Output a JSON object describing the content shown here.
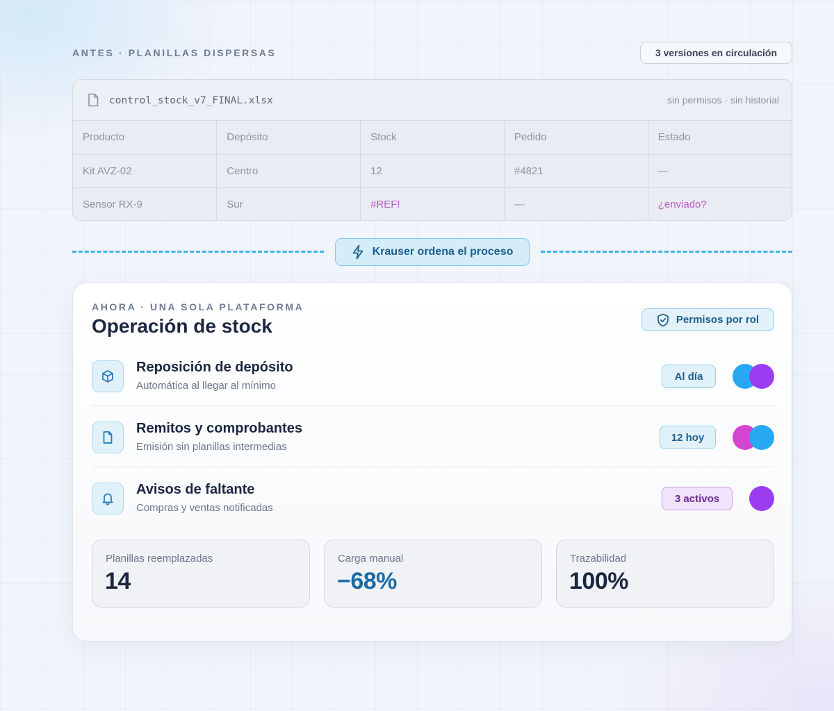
{
  "before": {
    "label": "ANTES · PLANILLAS DISPERSAS",
    "versions_badge": "3 versiones en circulación",
    "file": {
      "icon": "file-icon",
      "name": "control_stock_v7_FINAL.xlsx",
      "meta": "sin permisos · sin historial"
    },
    "columns": [
      "Producto",
      "Depósito",
      "Stock",
      "Pedido",
      "Estado"
    ],
    "rows": [
      [
        "Kit AVZ-02",
        "Centro",
        "12",
        "#4821",
        "—"
      ],
      [
        "Sensor RX-9",
        "Sur",
        "#REF!",
        "—",
        "¿enviado?"
      ]
    ]
  },
  "divider": {
    "label": "Krauser ordena el proceso",
    "icon": "lightning-icon"
  },
  "after": {
    "label": "AHORA · UNA SOLA PLATAFORMA",
    "title": "Operación de stock",
    "permissions_badge": "Permisos por rol",
    "permissions_icon": "shield-check-icon",
    "processes": [
      {
        "icon": "box-icon",
        "title": "Reposición de depósito",
        "subtitle": "Automática al llegar al mínimo",
        "status": "Al día",
        "status_tone": "blue",
        "avatars": [
          "#27a9f1",
          "#9b3cf0"
        ]
      },
      {
        "icon": "document-icon",
        "title": "Remitos y comprobantes",
        "subtitle": "Emisión sin planillas intermedias",
        "status": "12 hoy",
        "status_tone": "blue",
        "avatars": [
          "#d445d0",
          "#27a9f1"
        ]
      },
      {
        "icon": "bell-icon",
        "title": "Avisos de faltante",
        "subtitle": "Compras y ventas notificadas",
        "status": "3 activos",
        "status_tone": "purple",
        "avatars": [
          "#9b3cf0"
        ]
      }
    ],
    "kpis": [
      {
        "label": "Planillas reemplazadas",
        "value": "14"
      },
      {
        "label": "Carga manual",
        "value": "−68%"
      },
      {
        "label": "Trazabilidad",
        "value": "100%"
      }
    ]
  },
  "colors": {
    "accent": "#1c6aa6",
    "dash": "#3fb4ea",
    "error_text": "#b65bc2"
  }
}
